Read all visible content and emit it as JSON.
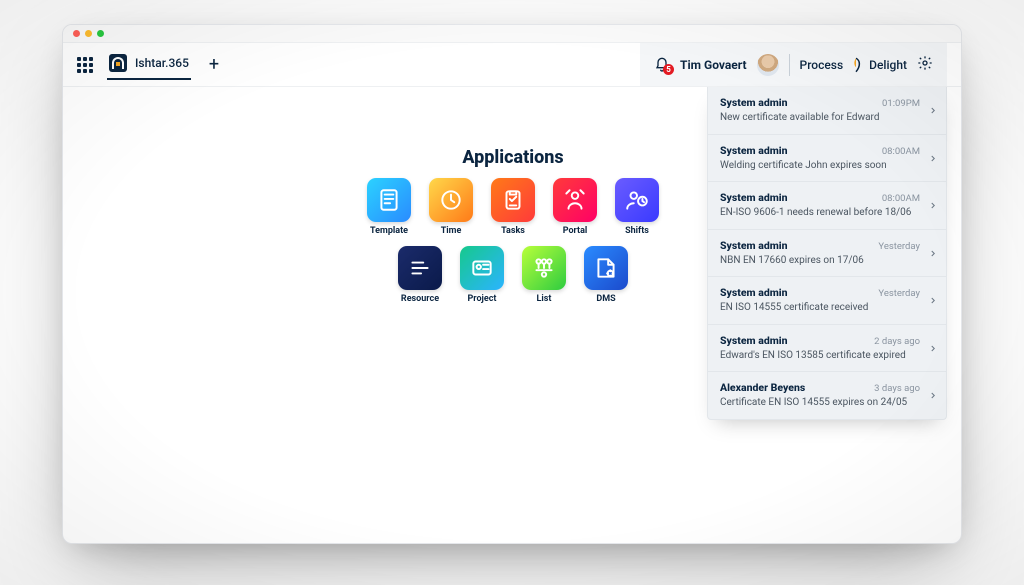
{
  "tab": {
    "label": "Ishtar.365"
  },
  "header": {
    "user_name": "Tim Govaert",
    "brand_left": "Process",
    "brand_right": "Delight",
    "notif_count": "5"
  },
  "apps_title": "Applications",
  "apps": [
    {
      "key": "template",
      "label": "Template"
    },
    {
      "key": "time",
      "label": "Time"
    },
    {
      "key": "tasks",
      "label": "Tasks"
    },
    {
      "key": "portal",
      "label": "Portal"
    },
    {
      "key": "shifts",
      "label": "Shifts"
    },
    {
      "key": "resource",
      "label": "Resource"
    },
    {
      "key": "project",
      "label": "Project"
    },
    {
      "key": "list",
      "label": "List"
    },
    {
      "key": "dms",
      "label": "DMS"
    }
  ],
  "notifications": [
    {
      "sender": "System admin",
      "time": "01:09PM",
      "msg": "New certificate available for Edward"
    },
    {
      "sender": "System admin",
      "time": "08:00AM",
      "msg": "Welding certificate John expires soon"
    },
    {
      "sender": "System admin",
      "time": "08:00AM",
      "msg": "EN-ISO 9606-1 needs renewal before 18/06"
    },
    {
      "sender": "System admin",
      "time": "Yesterday",
      "msg": "NBN EN 17660 expires on 17/06"
    },
    {
      "sender": "System admin",
      "time": "Yesterday",
      "msg": "EN ISO 14555 certificate received"
    },
    {
      "sender": "System admin",
      "time": "2 days ago",
      "msg": "Edward's EN ISO 13585 certificate expired"
    },
    {
      "sender": "Alexander Beyens",
      "time": "3 days ago",
      "msg": "Certificate EN ISO 14555 expires on 24/05"
    }
  ]
}
